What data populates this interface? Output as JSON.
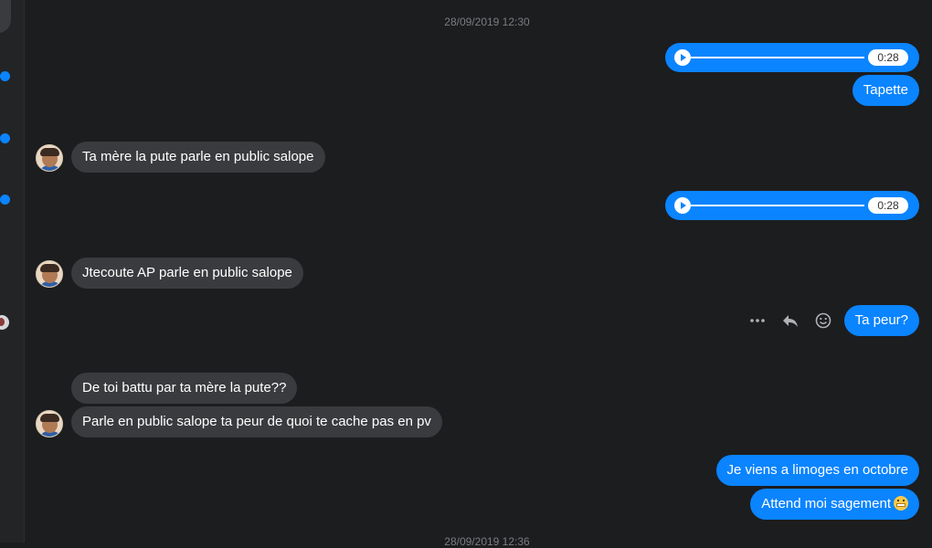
{
  "timestamps": {
    "top": "28/09/2019 12:30",
    "bottom": "28/09/2019 12:36"
  },
  "conversation": {
    "audio_durations": [
      "0:28",
      "0:28"
    ],
    "messages": {
      "out_1": "Tapette",
      "in_1": "Ta mère la pute parle en public salope",
      "in_2": "Jtecoute AP parle en public salope",
      "out_2": "Ta peur?",
      "in_3": "De toi battu par ta mère la pute??",
      "in_4": "Parle en public salope ta peur de quoi te cache pas en pv",
      "out_3": "Je viens a limoges en octobre",
      "out_4": "Attend moi sagement"
    }
  },
  "message_actions": {
    "more_icon": "more-dots-icon",
    "reply_icon": "reply-icon",
    "react_icon": "smiley-icon"
  },
  "colors": {
    "background": "#1c1d1f",
    "sidebar": "#232426",
    "incoming_bubble": "#3a3b3e",
    "outgoing_bubble": "#0a84ff",
    "timestamp": "#7b7c80"
  }
}
